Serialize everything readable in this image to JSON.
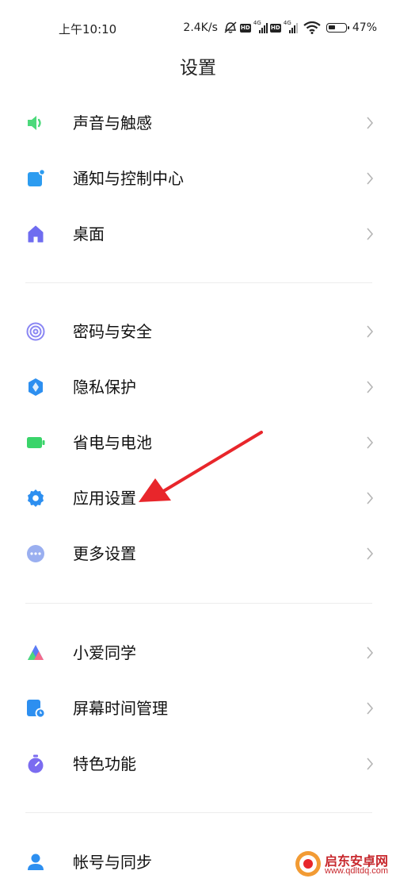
{
  "status_bar": {
    "time": "上午10:10",
    "speed": "2.4K/s",
    "battery": "47%",
    "battery_level": 0.47
  },
  "header": {
    "title": "设置"
  },
  "items": [
    {
      "label": "声音与触感",
      "icon": "speaker-icon",
      "color": "#4cd97b"
    },
    {
      "label": "通知与控制中心",
      "icon": "notification-icon",
      "color": "#2d9cf0"
    },
    {
      "label": "桌面",
      "icon": "home-icon",
      "color": "#6f6cf0"
    },
    {
      "label": "密码与安全",
      "icon": "fingerprint-icon",
      "color": "#8a86f3"
    },
    {
      "label": "隐私保护",
      "icon": "privacy-shield-icon",
      "color": "#2d8ff0"
    },
    {
      "label": "省电与电池",
      "icon": "battery-icon",
      "color": "#3ad46a"
    },
    {
      "label": "应用设置",
      "icon": "gear-icon",
      "color": "#2d8ff0"
    },
    {
      "label": "更多设置",
      "icon": "more-dots-icon",
      "color": "#9aaff0"
    },
    {
      "label": "小爱同学",
      "icon": "xiaoai-icon",
      "color": "#5b7cf5"
    },
    {
      "label": "屏幕时间管理",
      "icon": "screen-time-icon",
      "color": "#2d8ff0"
    },
    {
      "label": "特色功能",
      "icon": "stopwatch-icon",
      "color": "#7b6cf0"
    },
    {
      "label": "帐号与同步",
      "icon": "account-icon",
      "color": "#2d8ff0"
    }
  ],
  "watermark": {
    "text": "启东安卓网",
    "url": "www.qdltdq.com"
  }
}
